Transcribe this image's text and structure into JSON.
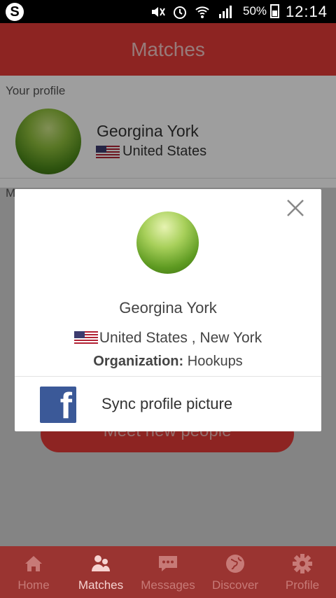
{
  "status_bar": {
    "app_badge": "S",
    "battery": "50%",
    "time": "12:14"
  },
  "header": {
    "title": "Matches"
  },
  "profile_section": {
    "label": "Your profile",
    "name": "Georgina York",
    "country": "United States",
    "next_section_label_fragment": "M"
  },
  "background_button": {
    "label": "Meet new people"
  },
  "modal": {
    "name": "Georgina York",
    "location": "United States , New York",
    "organization_label": "Organization:",
    "organization_value": "Hookups",
    "sync_label": "Sync profile picture"
  },
  "bottom_nav": {
    "items": [
      {
        "label": "Home",
        "icon": "home-icon",
        "active": false
      },
      {
        "label": "Matches",
        "icon": "people-icon",
        "active": true
      },
      {
        "label": "Messages",
        "icon": "chat-icon",
        "active": false
      },
      {
        "label": "Discover",
        "icon": "globe-icon",
        "active": false
      },
      {
        "label": "Profile",
        "icon": "gear-icon",
        "active": false
      }
    ]
  },
  "colors": {
    "brand_red": "#e43a37",
    "facebook_blue": "#3b5998"
  }
}
